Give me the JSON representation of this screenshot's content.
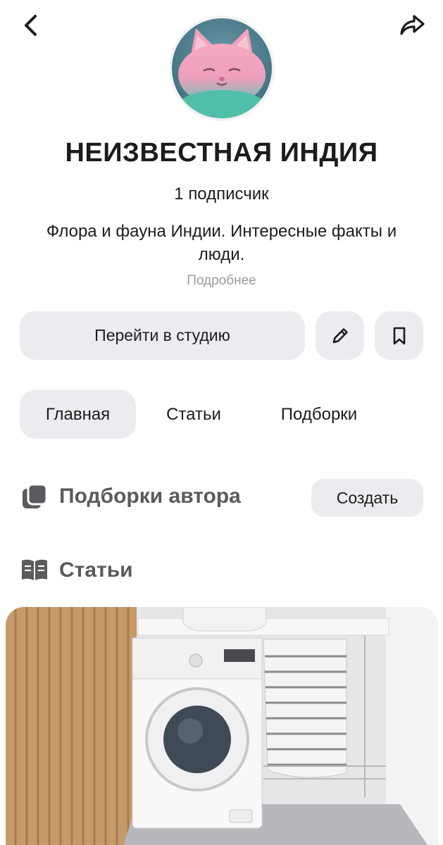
{
  "channel": {
    "title": "НЕИЗВЕСТНАЯ ИНДИЯ",
    "subscribers": "1 подписчик",
    "description": "Флора и фауна Индии. Интересные факты и люди.",
    "more_link": "Подробнее"
  },
  "actions": {
    "studio_label": "Перейти в студию",
    "edit_icon": "pencil-icon",
    "bookmark_icon": "bookmark-icon"
  },
  "tabs": [
    {
      "label": "Главная",
      "active": true
    },
    {
      "label": "Статьи",
      "active": false
    },
    {
      "label": "Подборки",
      "active": false
    }
  ],
  "sections": {
    "collections": {
      "title": "Подборки автора",
      "create_label": "Создать",
      "icon": "collections-icon"
    },
    "articles": {
      "title": "Статьи",
      "icon": "book-icon"
    }
  },
  "header": {
    "back_icon": "back-arrow-icon",
    "share_icon": "share-icon"
  },
  "colors": {
    "button_bg": "#ececf0",
    "muted_text": "#9a9aa0",
    "section_text": "#5a5a5f"
  }
}
